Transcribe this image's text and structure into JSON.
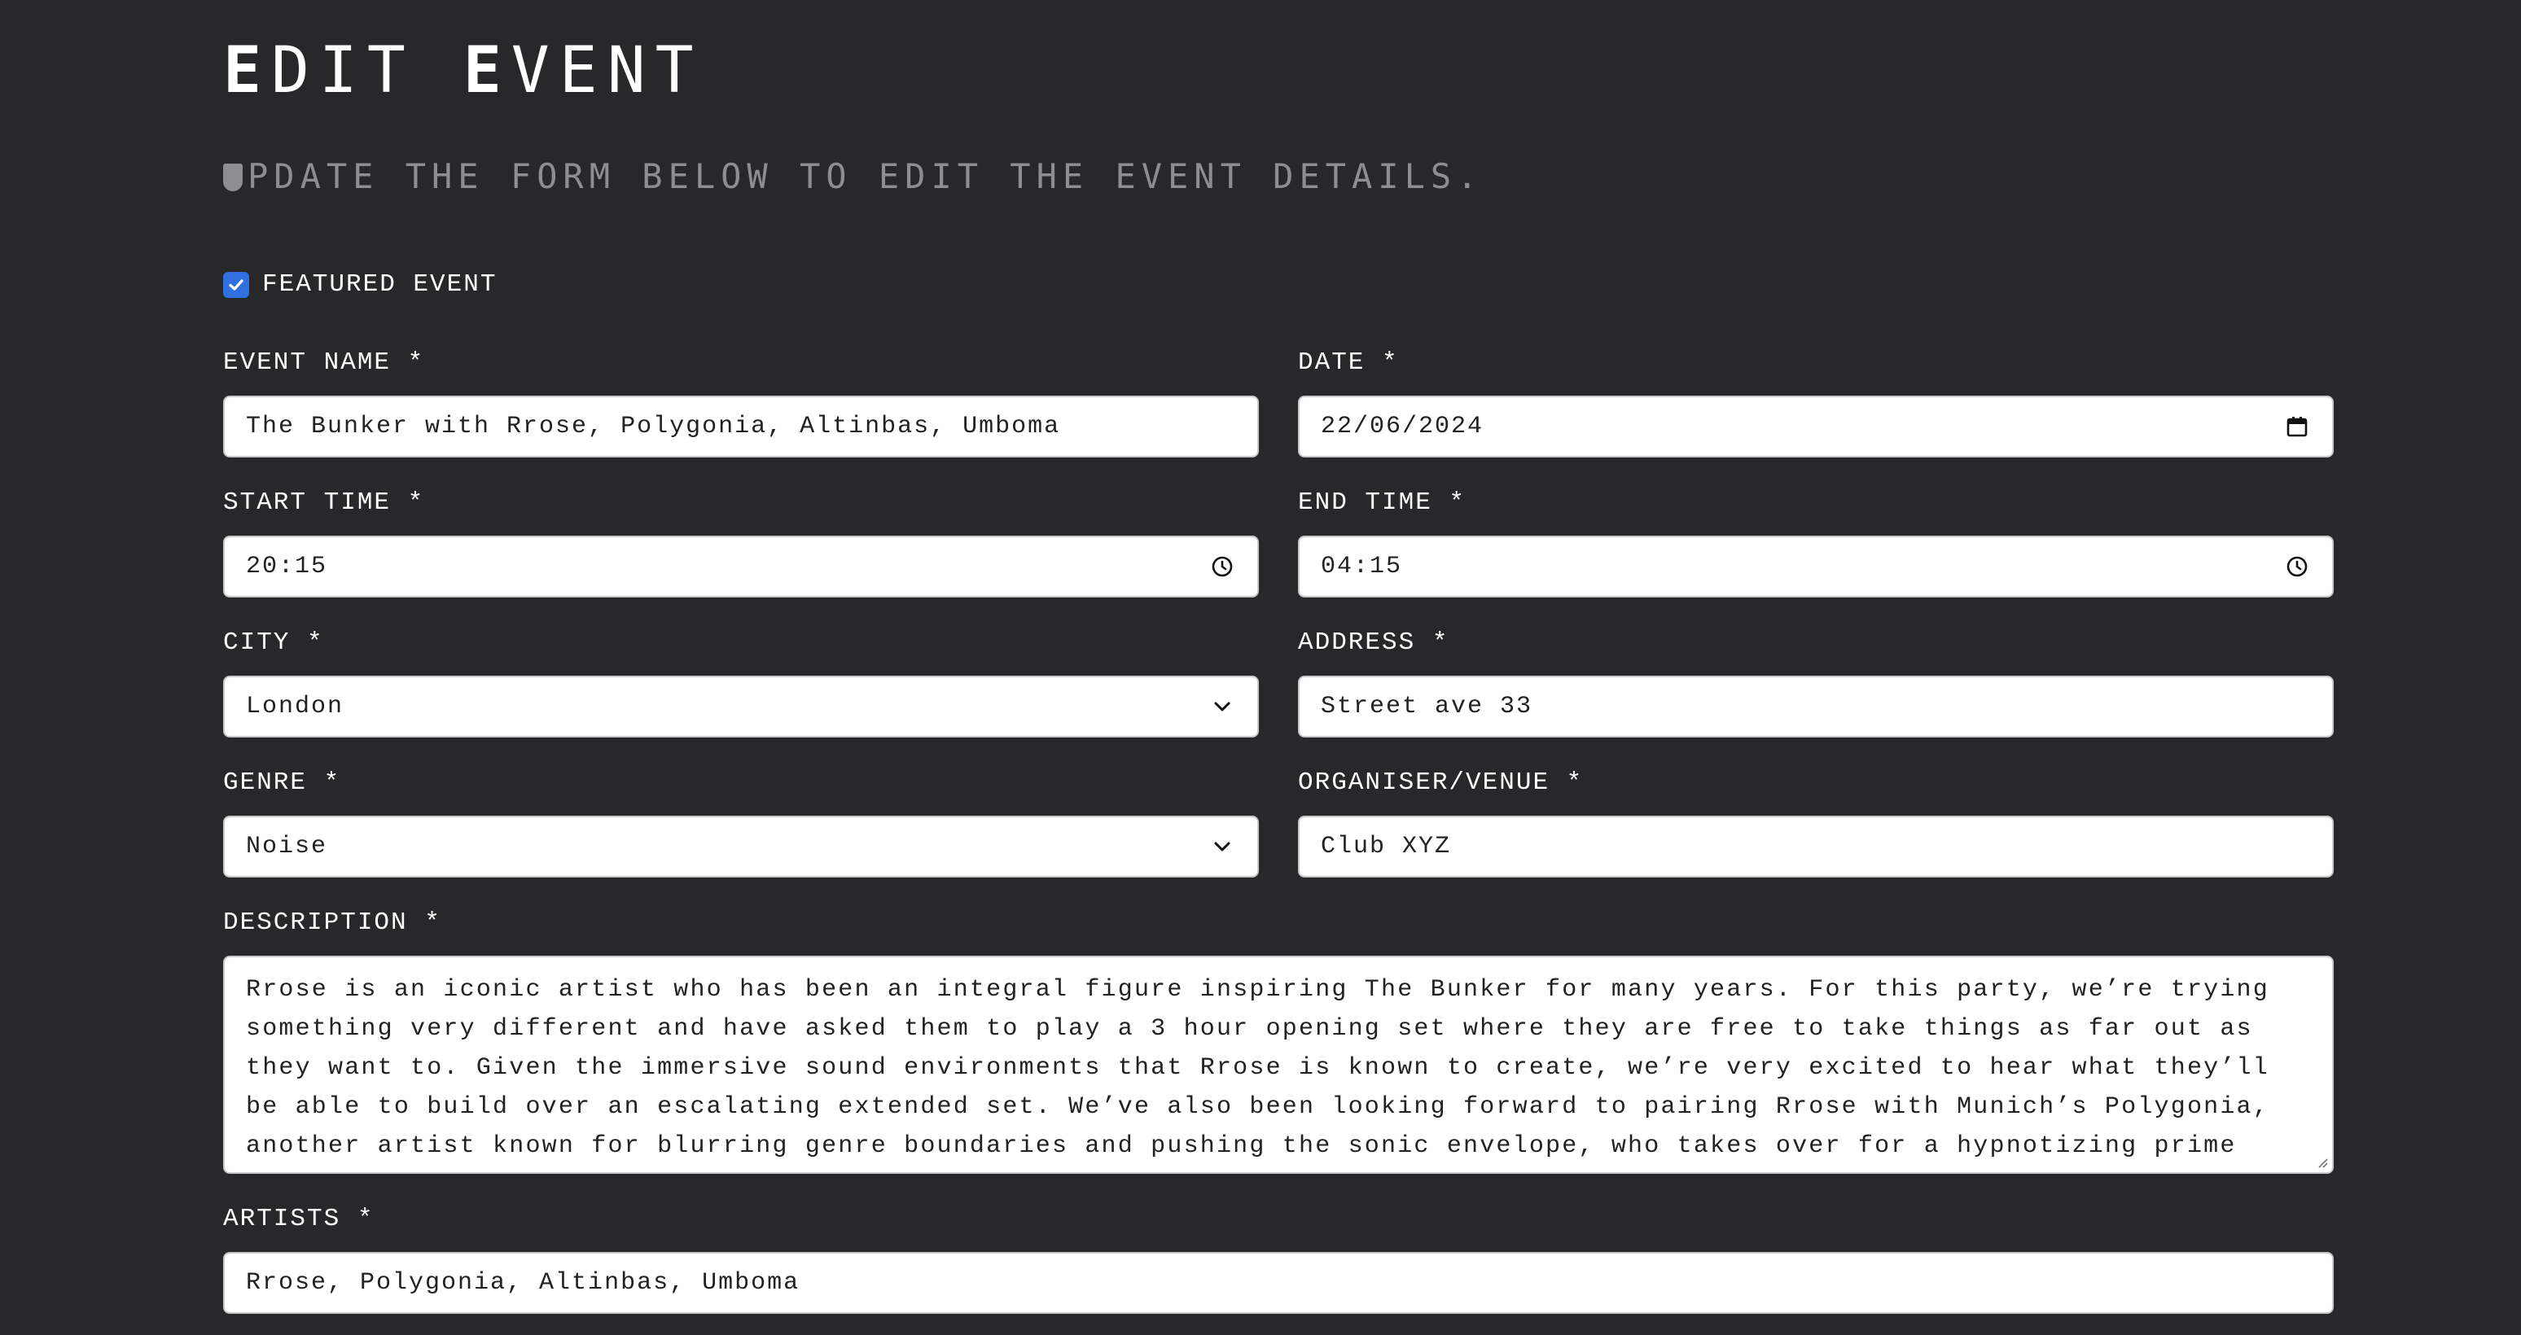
{
  "header": {
    "title_first": "E",
    "title_rest": "DIT ",
    "title_second_first": "E",
    "title_second_rest": "VENT",
    "subtitle": "PDATE THE FORM BELOW TO EDIT THE EVENT DETAILS."
  },
  "featured": {
    "label": "FEATURED EVENT",
    "checked": true
  },
  "fields": {
    "event_name": {
      "label": "EVENT NAME *",
      "value": "The Bunker with Rrose, Polygonia, Altinbas, Umboma"
    },
    "date": {
      "label": "DATE *",
      "value": "22/06/2024",
      "icon": "calendar-icon"
    },
    "start_time": {
      "label": "START TIME *",
      "value": "20:15",
      "icon": "clock-icon"
    },
    "end_time": {
      "label": "END TIME *",
      "value": "04:15",
      "icon": "clock-icon"
    },
    "city": {
      "label": "CITY *",
      "value": "London",
      "icon": "chevron-down-icon"
    },
    "address": {
      "label": "ADDRESS *",
      "value": "Street ave 33"
    },
    "genre": {
      "label": "GENRE *",
      "value": "Noise",
      "icon": "chevron-down-icon"
    },
    "organiser": {
      "label": "ORGANISER/VENUE *",
      "value": "Club XYZ"
    },
    "description": {
      "label": "DESCRIPTION *",
      "value": "Rrose is an iconic artist who has been an integral figure inspiring The Bunker for many years. For this party, we’re trying something very different and have asked them to play a 3 hour opening set where they are free to take things as far out as they want to. Given the immersive sound environments that Rrose is known to create, we’re very excited to hear what they’ll be able to build over an escalating extended set. We’ve also been looking forward to pairing Rrose with Munich’s Polygonia, another artist known for blurring genre boundaries and pushing the sonic envelope, who takes over for a hypnotizing prime time set. Rrose and"
    },
    "artists": {
      "label": "ARTISTS *",
      "value": "Rrose, Polygonia, Altinbas, Umboma"
    }
  },
  "colors": {
    "background": "#28282b",
    "checkbox": "#2f6fe0",
    "subtitle": "#8e8e92"
  }
}
